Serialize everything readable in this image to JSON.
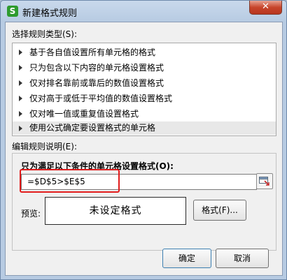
{
  "window": {
    "title": "新建格式规则",
    "app_icon": "S",
    "close_symbol": "✕"
  },
  "rule_types": {
    "label": "选择规则类型(S):",
    "items": [
      {
        "label": "基于各自值设置所有单元格的格式"
      },
      {
        "label": "只为包含以下内容的单元格设置格式"
      },
      {
        "label": "仅对排名靠前或靠后的数值设置格式"
      },
      {
        "label": "仅对高于或低于平均值的数值设置格式"
      },
      {
        "label": "仅对唯一值或重复值设置格式"
      },
      {
        "label": "使用公式确定要设置格式的单元格"
      }
    ],
    "selected_index": 5
  },
  "description": {
    "label": "编辑规则说明(E):",
    "formula_label": "只为满足以下条件的单元格设置格式(O):",
    "formula_value": "=$D$5>$E$5",
    "preview_label": "预览:",
    "preview_text": "未设定格式",
    "format_button": "格式(F)..."
  },
  "footer": {
    "ok": "确定",
    "cancel": "取消"
  },
  "colors": {
    "highlight_border": "#e11b1b",
    "app_icon": "#2e9b2e",
    "close_button": "#c7452c"
  },
  "icons": {
    "app": "wps-spreadsheet-icon",
    "close": "close-icon",
    "range_select": "range-select-icon",
    "list_arrow": "triangle-right-icon"
  }
}
